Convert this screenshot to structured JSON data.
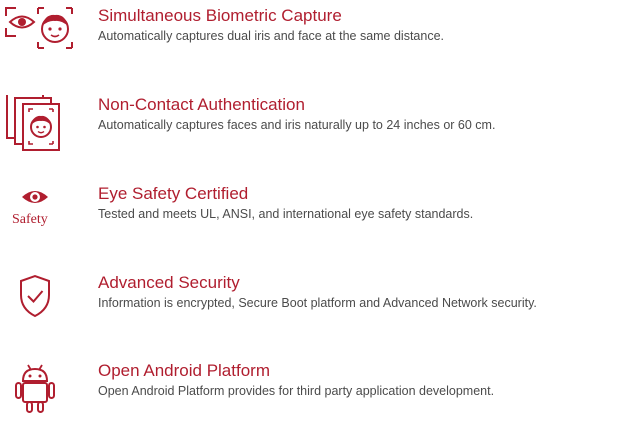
{
  "brand_color": "#b01e2f",
  "features": [
    {
      "icon": "eye-face-scan-icon",
      "title": "Simultaneous Biometric Capture",
      "description": "Automatically captures dual iris and face at the same distance."
    },
    {
      "icon": "stacked-face-frames-icon",
      "title": "Non-Contact Authentication",
      "description": "Automatically captures faces and iris naturally up to 24 inches or 60 cm."
    },
    {
      "icon": "eye-safety-icon",
      "icon_label": "Safety",
      "title": "Eye Safety Certified",
      "description": "Tested and meets UL, ANSI, and international eye safety standards."
    },
    {
      "icon": "shield-check-icon",
      "title": "Advanced Security",
      "description": "Information is encrypted, Secure Boot platform and Advanced Network security."
    },
    {
      "icon": "android-icon",
      "title": "Open Android Platform",
      "description": "Open Android Platform provides for third party application development."
    }
  ]
}
